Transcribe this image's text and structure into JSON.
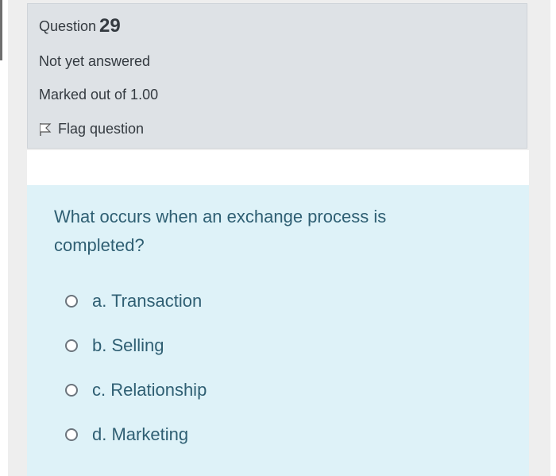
{
  "question": {
    "label": "Question",
    "number": "29",
    "status": "Not yet answered",
    "marks": "Marked out of 1.00",
    "flag_label": "Flag question",
    "text": "What occurs when an exchange process is completed?"
  },
  "answers": [
    {
      "label": "a. Transaction"
    },
    {
      "label": "b. Selling"
    },
    {
      "label": "c. Relationship"
    },
    {
      "label": "d. Marketing"
    }
  ],
  "colors": {
    "info_panel": "#dee2e6",
    "question_panel": "#def2f8",
    "question_text": "#2f5f73"
  },
  "icons": {
    "flag": "flag-icon",
    "radio": "radio-icon"
  }
}
